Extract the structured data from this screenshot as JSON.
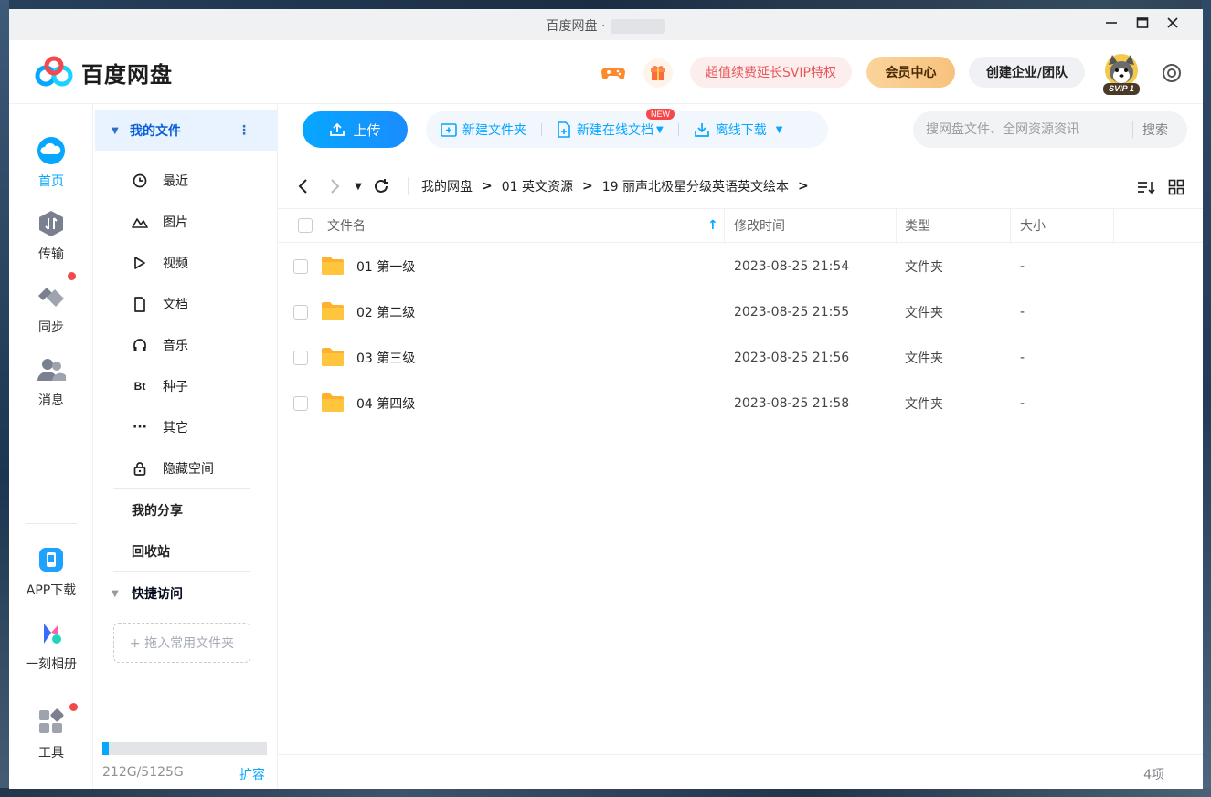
{
  "window": {
    "title": "百度网盘 ·"
  },
  "header": {
    "logo_text": "百度网盘",
    "svip_promo": "超值续费延长SVIP特权",
    "vip_center": "会员中心",
    "create_team": "创建企业/团队",
    "avatar_badge": "SVIP 1"
  },
  "leftnav": {
    "items": [
      {
        "label": "首页",
        "icon": "cloud-icon",
        "active": true
      },
      {
        "label": "传输",
        "icon": "transfer-icon"
      },
      {
        "label": "同步",
        "icon": "sync-icon",
        "badge": true
      },
      {
        "label": "消息",
        "icon": "message-icon"
      },
      {
        "label": "APP下载",
        "icon": "phone-icon"
      },
      {
        "label": "一刻相册",
        "icon": "album-icon"
      },
      {
        "label": "工具",
        "icon": "tools-icon",
        "badge": true
      }
    ]
  },
  "sidebar": {
    "my_files": "我的文件",
    "items": [
      {
        "label": "最近",
        "icon": "clock-icon"
      },
      {
        "label": "图片",
        "icon": "image-icon"
      },
      {
        "label": "视频",
        "icon": "play-icon"
      },
      {
        "label": "文档",
        "icon": "document-icon"
      },
      {
        "label": "音乐",
        "icon": "headphones-icon"
      },
      {
        "label": "种子",
        "icon": "bt-icon"
      },
      {
        "label": "其它",
        "icon": "more-dots-icon"
      },
      {
        "label": "隐藏空间",
        "icon": "lock-icon"
      }
    ],
    "my_share": "我的分享",
    "recycle": "回收站",
    "quick_access": "快捷访问",
    "drop_hint": "+ 拖入常用文件夹",
    "quota_text": "212G/5125G",
    "quota_used_fraction": 0.041,
    "expand": "扩容"
  },
  "toolbar": {
    "upload": "上传",
    "new_folder": "新建文件夹",
    "new_online_doc": "新建在线文档",
    "new_badge": "NEW",
    "offline_download": "离线下载",
    "search_placeholder": "搜网盘文件、全网资源资讯",
    "search_button": "搜索"
  },
  "breadcrumb": [
    "我的网盘",
    "01 英文资源",
    "19 丽声北极星分级英语英文绘本"
  ],
  "table": {
    "columns": [
      "文件名",
      "修改时间",
      "类型",
      "大小"
    ],
    "rows": [
      {
        "name": "01 第一级",
        "modified": "2023-08-25 21:54",
        "type": "文件夹",
        "size": "-"
      },
      {
        "name": "02 第二级",
        "modified": "2023-08-25 21:55",
        "type": "文件夹",
        "size": "-"
      },
      {
        "name": "03 第三级",
        "modified": "2023-08-25 21:56",
        "type": "文件夹",
        "size": "-"
      },
      {
        "name": "04 第四级",
        "modified": "2023-08-25 21:58",
        "type": "文件夹",
        "size": "-"
      }
    ]
  },
  "footer": {
    "count": "4项"
  },
  "colors": {
    "accent": "#06a7ff",
    "sidebar_active_bg": "#e8f3ff",
    "badge_red": "#f5484d",
    "folder_yellow": "#ffc53d"
  }
}
